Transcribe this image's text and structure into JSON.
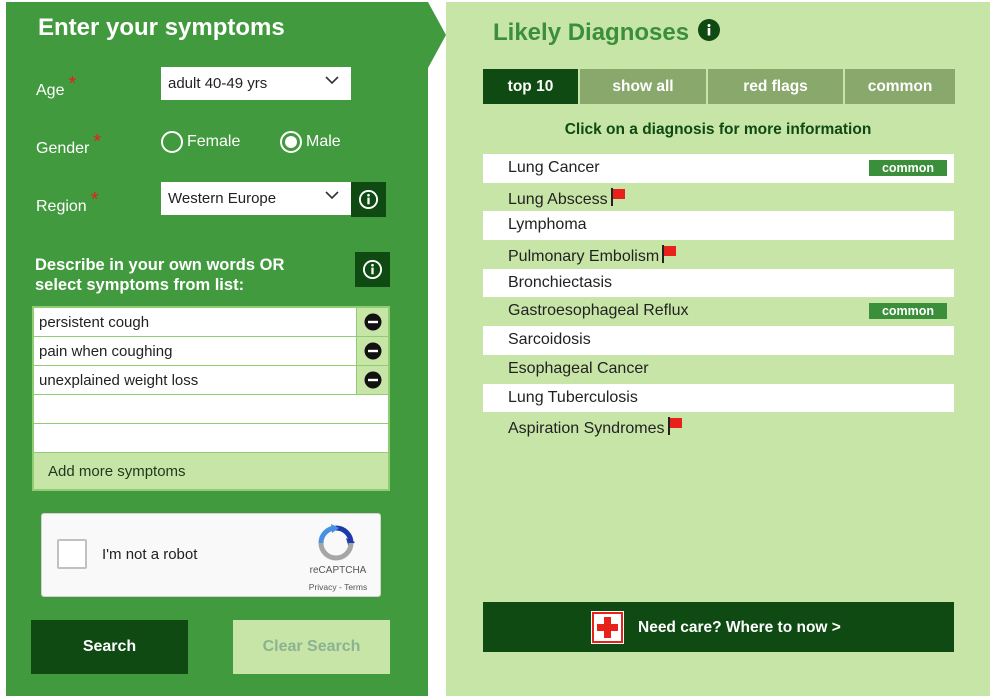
{
  "left": {
    "title": "Enter your symptoms",
    "age": {
      "label": "Age",
      "required_mark": "*",
      "value": "adult 40-49 yrs"
    },
    "gender": {
      "label": "Gender",
      "required_mark": "*",
      "options": [
        "Female",
        "Male"
      ],
      "selected": "Male"
    },
    "region": {
      "label": "Region",
      "required_mark": "*",
      "value": "Western Europe"
    },
    "describe": {
      "line1": "Describe in your own words OR",
      "line2": "select symptoms from list:"
    },
    "symptoms": [
      "persistent cough",
      "pain when coughing",
      "unexplained weight loss"
    ],
    "add_more": "Add more symptoms",
    "captcha": {
      "label": "I'm not a robot",
      "brand": "reCAPTCHA",
      "links": "Privacy - Terms"
    },
    "search_label": "Search",
    "clear_label": "Clear Search"
  },
  "right": {
    "title": "Likely Diagnoses",
    "tabs": [
      "top 10",
      "show all",
      "red flags",
      "common"
    ],
    "active_tab": "top 10",
    "hint": "Click on a diagnosis for more information",
    "diagnoses": [
      {
        "name": "Lung Cancer",
        "badge": "common"
      },
      {
        "name": "Lung Abscess",
        "flag": "red-flag-icon"
      },
      {
        "name": "Lymphoma"
      },
      {
        "name": "Pulmonary Embolism",
        "flag": "red-flag-icon"
      },
      {
        "name": "Bronchiectasis"
      },
      {
        "name": "Gastroesophageal Reflux",
        "badge": "common"
      },
      {
        "name": "Sarcoidosis"
      },
      {
        "name": "Esophageal Cancer"
      },
      {
        "name": "Lung Tuberculosis"
      },
      {
        "name": "Aspiration Syndromes",
        "flag": "red-flag-icon"
      }
    ],
    "care_label": "Need care?  Where to now >"
  },
  "colors": {
    "left_panel": "#429a3e",
    "right_panel": "#c8e5a8",
    "dark_green": "#0e4a12",
    "title_green": "#3b8f3a",
    "required_red": "#e2231a",
    "flag_red": "#e8221b"
  }
}
